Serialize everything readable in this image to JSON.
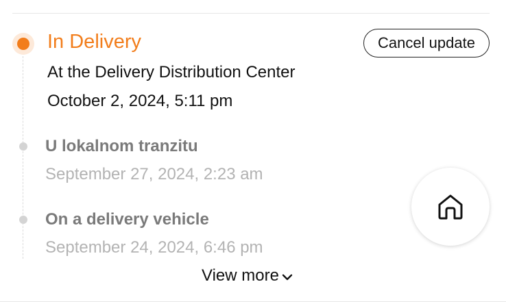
{
  "accent_color": "#f27d1b",
  "current": {
    "status": "In Delivery",
    "location": "At the Delivery Distribution Center",
    "date": "October 2, 2024, 5:11 pm"
  },
  "cancel_button_label": "Cancel update",
  "history": [
    {
      "status": "U lokalnom tranzitu",
      "date": "September 27, 2024, 2:23 am"
    },
    {
      "status": "On a delivery vehicle",
      "date": "September 24, 2024, 6:46 pm"
    }
  ],
  "view_more_label": "View more",
  "icons": {
    "home": "home-icon",
    "chevron": "chevron-down-icon"
  }
}
